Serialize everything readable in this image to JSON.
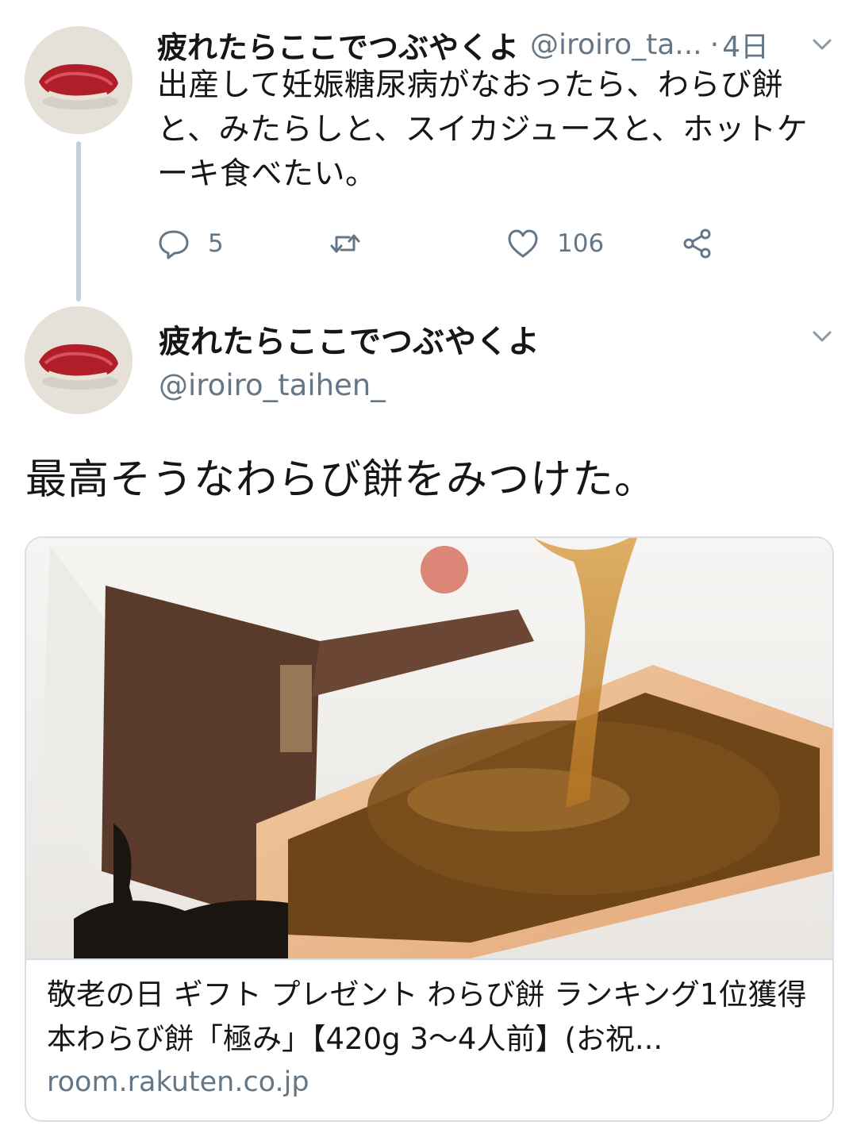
{
  "tweet1": {
    "display_name": "疲れたらここでつぶやくよ",
    "handle": "@iroiro_ta...",
    "separator": "·",
    "time": "4日",
    "text": "出産して妊娠糖尿病がなおったら、わらび餅と、みたらしと、スイカジュースと、ホットケーキ食べたい。",
    "actions": {
      "reply_count": "5",
      "retweet_count": "",
      "like_count": "106"
    }
  },
  "tweet2": {
    "display_name": "疲れたらここでつぶやくよ",
    "handle": "@iroiro_taihen_",
    "text": "最高そうなわらび餅をみつけた。",
    "card": {
      "title": "敬老の日 ギフト プレゼント わらび餅 ランキング1位獲得　本わらび餅「極み」【420g 3〜4人前】(お祝...",
      "domain": "room.rakuten.co.jp"
    }
  },
  "icons": {
    "reply": "reply-icon",
    "retweet": "retweet-icon",
    "like": "heart-icon",
    "share": "share-icon",
    "caret": "chevron-down-icon"
  },
  "colors": {
    "text_primary": "#14171a",
    "text_secondary": "#657786",
    "thread_line": "#c4cfd6",
    "card_border": "#d8dfe4"
  }
}
